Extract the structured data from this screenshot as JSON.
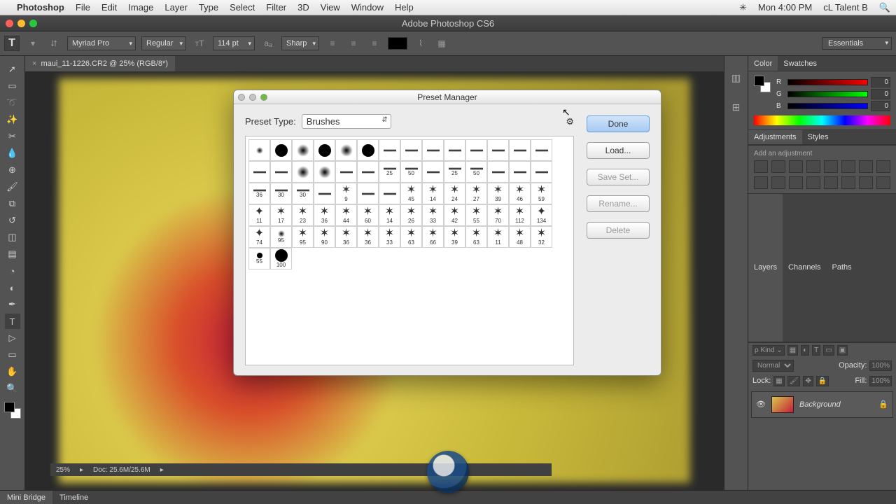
{
  "menubar": {
    "apple": "",
    "appname": "Photoshop",
    "items": [
      "File",
      "Edit",
      "Image",
      "Layer",
      "Type",
      "Select",
      "Filter",
      "3D",
      "View",
      "Window",
      "Help"
    ],
    "clock": "Mon 4:00 PM",
    "user": "cL Talent B"
  },
  "window": {
    "title": "Adobe Photoshop CS6"
  },
  "options": {
    "font": "Myriad Pro",
    "style": "Regular",
    "size": "114 pt",
    "aa": "Sharp",
    "workspace": "Essentials"
  },
  "document": {
    "tab": "maui_11-1226.CR2 @ 25% (RGB/8*)"
  },
  "dialog": {
    "title": "Preset Manager",
    "preset_type_label": "Preset Type:",
    "preset_type_value": "Brushes",
    "buttons": {
      "done": "Done",
      "load": "Load...",
      "save": "Save Set...",
      "rename": "Rename...",
      "delete": "Delete"
    },
    "brushes": [
      {
        "k": "soft"
      },
      {
        "k": "roundb"
      },
      {
        "k": "softb"
      },
      {
        "k": "roundb"
      },
      {
        "k": "softb"
      },
      {
        "k": "roundb"
      },
      {
        "k": "flat"
      },
      {
        "k": "flat"
      },
      {
        "k": "flat"
      },
      {
        "k": "flat"
      },
      {
        "k": "flat"
      },
      {
        "k": "flat"
      },
      {
        "k": "flat"
      },
      {
        "k": "flat"
      },
      {
        "k": "flat"
      },
      {
        "k": "flat"
      },
      {
        "k": "softb"
      },
      {
        "k": "softb"
      },
      {
        "k": "flat"
      },
      {
        "k": "flat"
      },
      {
        "k": "flat",
        "s": 25
      },
      {
        "k": "flat",
        "s": 50
      },
      {
        "k": "flat"
      },
      {
        "k": "flat",
        "s": 25
      },
      {
        "k": "flat",
        "s": 50
      },
      {
        "k": "flat"
      },
      {
        "k": "flat"
      },
      {
        "k": "flat"
      },
      {
        "k": "flat",
        "s": 36
      },
      {
        "k": "flat",
        "s": 30
      },
      {
        "k": "flat",
        "s": 30
      },
      {
        "k": "flat"
      },
      {
        "k": "tex",
        "s": 9
      },
      {
        "k": "flat"
      },
      {
        "k": "flat"
      },
      {
        "k": "tex",
        "s": 45
      },
      {
        "k": "tex",
        "s": 14
      },
      {
        "k": "tex",
        "s": 24
      },
      {
        "k": "tex",
        "s": 27
      },
      {
        "k": "tex",
        "s": 39
      },
      {
        "k": "tex",
        "s": 46
      },
      {
        "k": "tex",
        "s": 59
      },
      {
        "k": "scatter",
        "s": 11
      },
      {
        "k": "tex",
        "s": 17
      },
      {
        "k": "tex",
        "s": 23
      },
      {
        "k": "tex",
        "s": 36
      },
      {
        "k": "tex",
        "s": 44
      },
      {
        "k": "tex",
        "s": 60
      },
      {
        "k": "tex",
        "s": 14
      },
      {
        "k": "tex",
        "s": 26
      },
      {
        "k": "tex",
        "s": 33
      },
      {
        "k": "tex",
        "s": 42
      },
      {
        "k": "tex",
        "s": 55
      },
      {
        "k": "tex",
        "s": 70
      },
      {
        "k": "tex",
        "s": 112
      },
      {
        "k": "scatter",
        "s": 134
      },
      {
        "k": "scatter",
        "s": 74
      },
      {
        "k": "soft",
        "s": 95
      },
      {
        "k": "tex",
        "s": 95
      },
      {
        "k": "tex",
        "s": 90
      },
      {
        "k": "tex",
        "s": 36
      },
      {
        "k": "tex",
        "s": 36
      },
      {
        "k": "tex",
        "s": 33
      },
      {
        "k": "tex",
        "s": 63
      },
      {
        "k": "tex",
        "s": 66
      },
      {
        "k": "tex",
        "s": 39
      },
      {
        "k": "tex",
        "s": 63
      },
      {
        "k": "tex",
        "s": 11
      },
      {
        "k": "tex",
        "s": 48
      },
      {
        "k": "tex",
        "s": 32
      },
      {
        "k": "round",
        "s": 55
      },
      {
        "k": "roundb",
        "s": 100
      }
    ]
  },
  "panels": {
    "color_tab": "Color",
    "swatches_tab": "Swatches",
    "r": "R",
    "g": "G",
    "b": "B",
    "r_val": "0",
    "g_val": "0",
    "b_val": "0",
    "adjustments_tab": "Adjustments",
    "styles_tab": "Styles",
    "add_adjustment": "Add an adjustment",
    "layers_tab": "Layers",
    "channels_tab": "Channels",
    "paths_tab": "Paths",
    "kind": "Kind",
    "blend": "Normal",
    "opacity_lbl": "Opacity:",
    "opacity_val": "100%",
    "lock_lbl": "Lock:",
    "fill_lbl": "Fill:",
    "fill_val": "100%",
    "bg_layer": "Background"
  },
  "status": {
    "zoom": "25%",
    "doc": "Doc: 25.6M/25.6M"
  },
  "bottom_tabs": {
    "mini_bridge": "Mini Bridge",
    "timeline": "Timeline"
  }
}
